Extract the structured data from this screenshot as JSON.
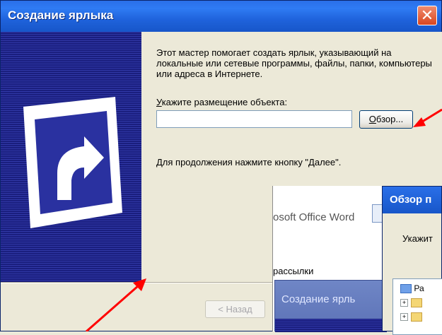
{
  "window": {
    "title": "Создание ярлыка",
    "close_label": "✕"
  },
  "content": {
    "description": "Этот мастер помогает создать ярлык, указывающий на локальные или сетевые программы, файлы, папки, компьютеры или адреса в Интернете.",
    "location_label_first": "У",
    "location_label_rest": "кажите размещение объекта:",
    "location_value": "",
    "browse_label_first": "О",
    "browse_label_rest": "бзор...",
    "continue_text": "Для продолжения нажмите кнопку \"Далее\"."
  },
  "footer": {
    "back_label": "< Назад"
  },
  "background_windows": {
    "word_title": "osoft Office Word",
    "word_item": "рассылки",
    "create_title": "Создание ярль",
    "browse_title": "Обзор п",
    "browse_prompt": "Укажит",
    "tree_first": "Ра"
  },
  "icons": [
    "shortcut-arrow-icon",
    "close-icon",
    "folder-icon",
    "desktop-icon",
    "word-doc-icon"
  ],
  "colors": {
    "titlebar": "#2158d8",
    "side_panel": "#1a1e7e",
    "annotation_arrow": "#ff0000"
  }
}
